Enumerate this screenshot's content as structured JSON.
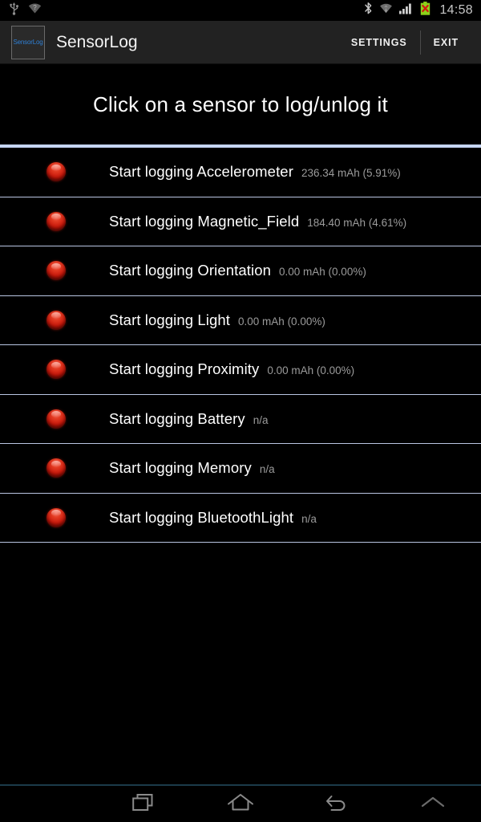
{
  "status_bar": {
    "left_icons": [
      {
        "name": "usb-icon",
        "label": "USB"
      },
      {
        "name": "wifi-unknown-icon",
        "label": "WiFi unknown"
      }
    ],
    "right_icons": [
      {
        "name": "bluetooth-icon",
        "label": "Bluetooth"
      },
      {
        "name": "wifi-icon",
        "label": "WiFi"
      },
      {
        "name": "cellular-signal-icon",
        "label": "Signal"
      },
      {
        "name": "battery-error-icon",
        "label": "Battery error"
      }
    ],
    "clock": "14:58"
  },
  "action_bar": {
    "app_icon_text": "SensorLog",
    "title": "SensorLog",
    "settings_label": "SETTINGS",
    "exit_label": "EXIT"
  },
  "main": {
    "headline": "Click on a sensor to log/unlog it",
    "sensors": [
      {
        "label": "Start logging Accelerometer",
        "stat": "236.34 mAh (5.91%)",
        "led": "off"
      },
      {
        "label": "Start logging Magnetic_Field",
        "stat": "184.40 mAh (4.61%)",
        "led": "off"
      },
      {
        "label": "Start logging Orientation",
        "stat": "0.00 mAh (0.00%)",
        "led": "off"
      },
      {
        "label": "Start logging Light",
        "stat": "0.00 mAh (0.00%)",
        "led": "off"
      },
      {
        "label": "Start logging Proximity",
        "stat": "0.00 mAh (0.00%)",
        "led": "off"
      },
      {
        "label": "Start logging Battery",
        "stat": "n/a",
        "led": "off"
      },
      {
        "label": "Start logging Memory",
        "stat": "n/a",
        "led": "off"
      },
      {
        "label": "Start logging BluetoothLight",
        "stat": "n/a",
        "led": "off"
      }
    ]
  },
  "nav_bar": {
    "buttons": [
      {
        "name": "recents-button",
        "icon": "recents-icon"
      },
      {
        "name": "home-button",
        "icon": "home-icon"
      },
      {
        "name": "back-button",
        "icon": "back-icon"
      },
      {
        "name": "expand-button",
        "icon": "chevron-up-icon"
      }
    ]
  },
  "colors": {
    "accent_rule": "#c6d6f5",
    "divider": "#b9c5e2",
    "action_bar_bg": "#222222",
    "led_red": "#c41408",
    "stat_text": "#9b9b9b",
    "nav_rule": "#1b3b4a"
  }
}
